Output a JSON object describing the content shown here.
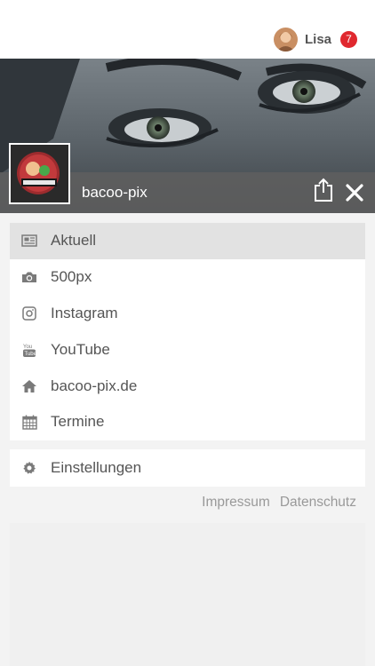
{
  "header": {
    "user_name": "Lisa",
    "notification_count": "7",
    "badge_color": "#e0282e"
  },
  "channel": {
    "name": "bacoo-pix",
    "share_icon": "share-icon",
    "close_icon": "close-icon"
  },
  "menu": {
    "items": [
      {
        "label": "Aktuell",
        "icon": "newspaper-icon",
        "active": true
      },
      {
        "label": "500px",
        "icon": "camera-icon"
      },
      {
        "label": "Instagram",
        "icon": "instagram-icon"
      },
      {
        "label": "YouTube",
        "icon": "youtube-icon"
      },
      {
        "label": "bacoo-pix.de",
        "icon": "home-icon"
      },
      {
        "label": "Termine",
        "icon": "calendar-icon"
      }
    ],
    "settings_label": "Einstellungen"
  },
  "footer": {
    "impressum": "Impressum",
    "datenschutz": "Datenschutz"
  }
}
